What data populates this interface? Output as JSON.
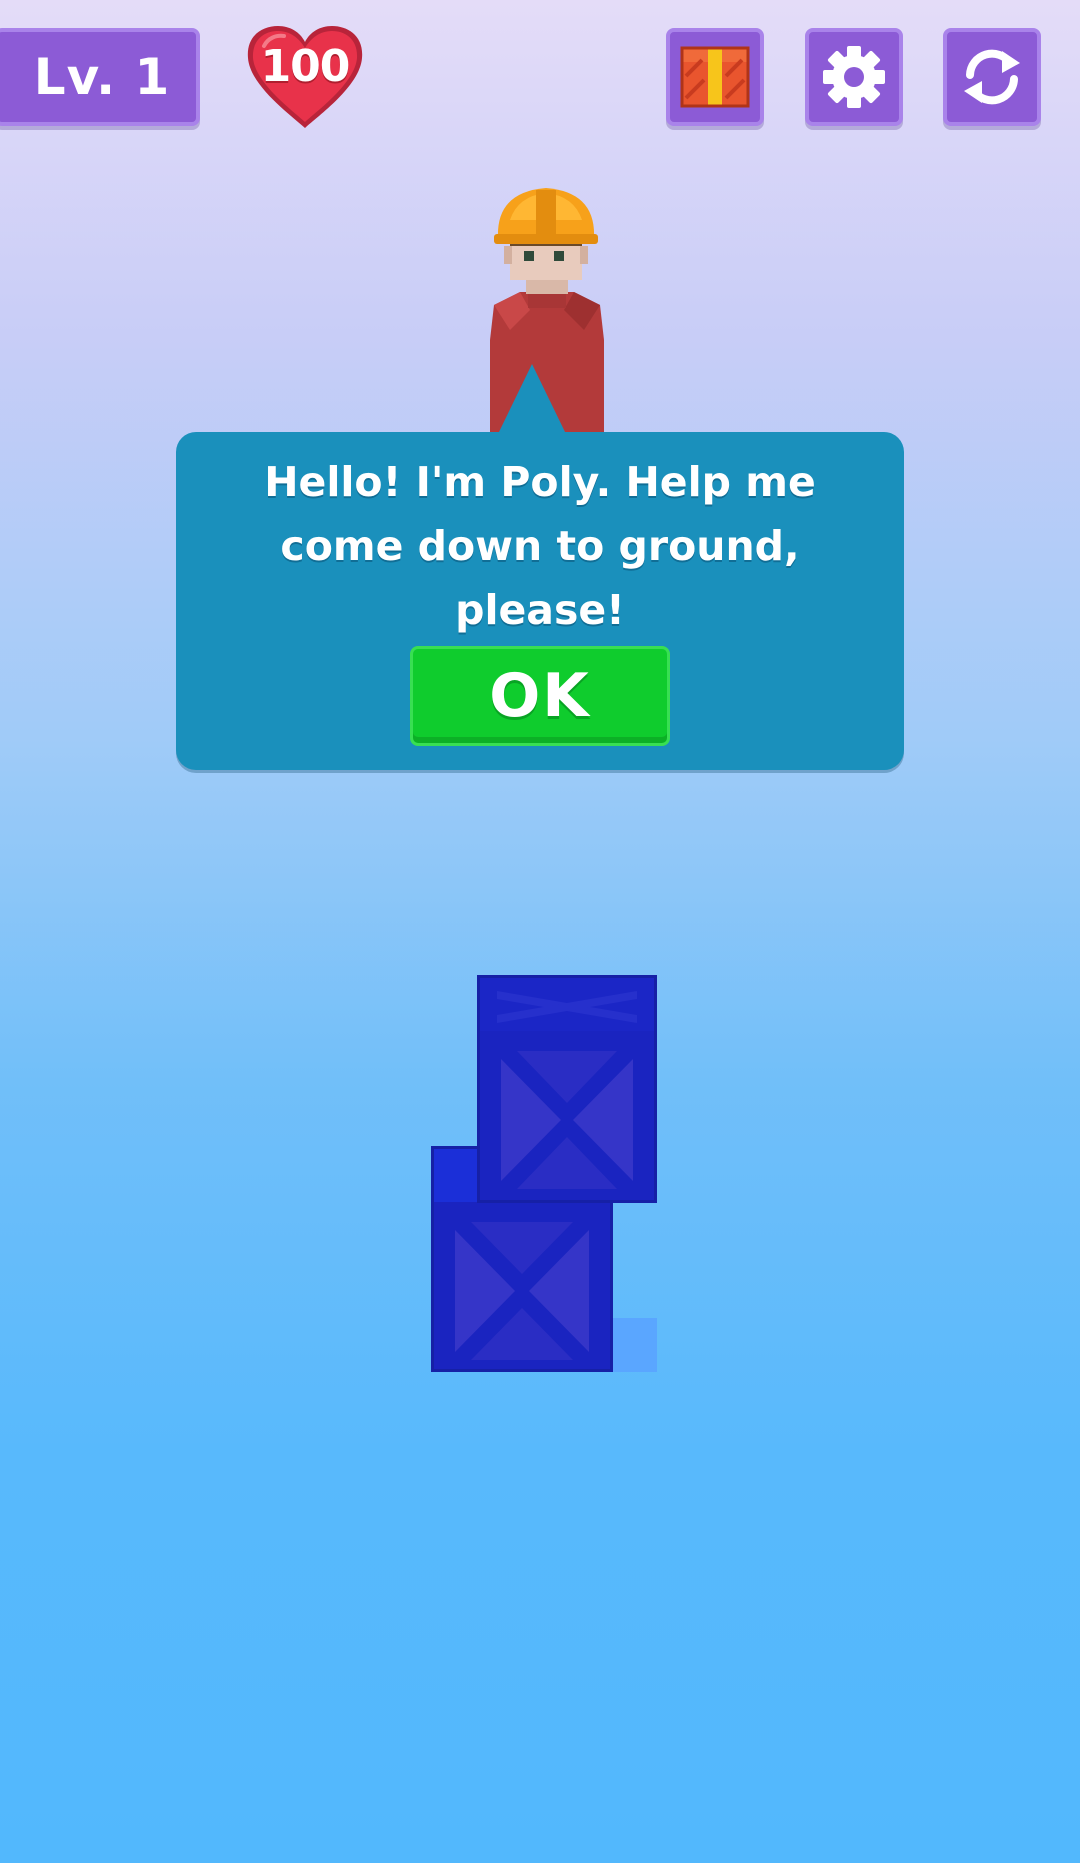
{
  "hud": {
    "level_label": "Lv. 1",
    "lives_count": "100",
    "heart_color": "#e8324a",
    "button_color": "#8c5bd6",
    "buttons": [
      {
        "name": "gift",
        "icon": "gift-icon"
      },
      {
        "name": "settings",
        "icon": "gear-icon"
      },
      {
        "name": "restart",
        "icon": "refresh-icon"
      }
    ]
  },
  "character": {
    "name": "Poly",
    "helmet_color": "#f7a11a",
    "shirt_color": "#b33a3a"
  },
  "dialog": {
    "message": "Hello! I'm Poly. Help me come down to ground, please!",
    "ok_label": "OK",
    "background_color": "#1a90bc",
    "ok_color": "#0fcc2d"
  },
  "crates": {
    "count": 2,
    "color": "#1a24c0"
  }
}
